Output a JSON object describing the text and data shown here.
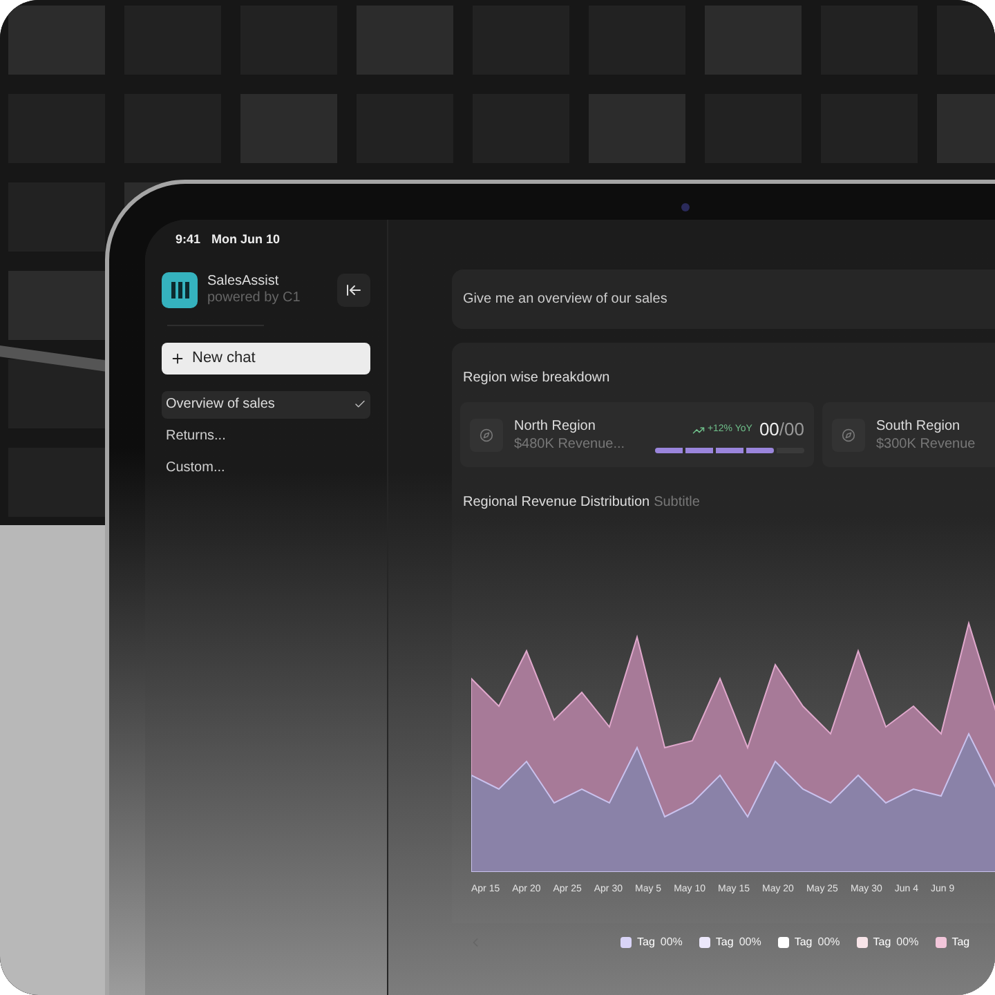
{
  "status_bar": {
    "time": "9:41",
    "date": "Mon Jun 10"
  },
  "sidebar": {
    "app_name": "SalesAssist",
    "app_subtitle": "powered by C1",
    "new_chat": "New chat",
    "items": [
      {
        "label": "Overview of sales",
        "selected": true
      },
      {
        "label": "Returns...",
        "selected": false
      },
      {
        "label": "Custom...",
        "selected": false
      }
    ]
  },
  "prompt": "Give me an overview of our sales",
  "breakdown": {
    "title": "Region wise breakdown",
    "regions": [
      {
        "name": "North Region",
        "revenue": "$480K Revenue...",
        "trend": "+12% YoY",
        "score": "00",
        "total": "/00",
        "level": 0.8
      },
      {
        "name": "South Region",
        "revenue": "$300K Revenue"
      }
    ]
  },
  "chart": {
    "title": "Regional Revenue Distribution",
    "subtitle": "Subtitle",
    "x_labels": [
      "Apr 15",
      "Apr 20",
      "Apr 25",
      "Apr 30",
      "May 5",
      "May 10",
      "May 15",
      "May 20",
      "May 25",
      "May 30",
      "Jun 4",
      "Jun 9"
    ],
    "legend": [
      {
        "label": "Tag",
        "value": "00%",
        "color": "#d9d4f7"
      },
      {
        "label": "Tag",
        "value": "00%",
        "color": "#ece8fb"
      },
      {
        "label": "Tag",
        "value": "00%",
        "color": "#ffffff"
      },
      {
        "label": "Tag",
        "value": "00%",
        "color": "#f7e4e8"
      },
      {
        "label": "Tag",
        "color": "#f2c6da"
      }
    ]
  }
}
